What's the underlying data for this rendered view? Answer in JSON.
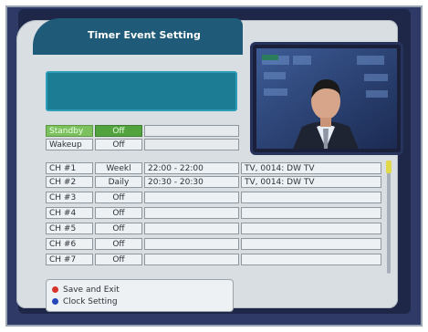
{
  "title": "Timer Event Setting",
  "standby": {
    "label": "Standby",
    "value": "Off"
  },
  "wakeup": {
    "label": "Wakeup",
    "value": "Off"
  },
  "rows": [
    {
      "ch": "CH #1",
      "mode": "Weekl",
      "time": "22:00 - 22:00",
      "channel": "TV, 0014: DW TV"
    },
    {
      "ch": "CH #2",
      "mode": "Daily",
      "time": "20:30 - 20:30",
      "channel": "TV, 0014: DW TV"
    },
    {
      "ch": "CH #3",
      "mode": "Off",
      "time": "",
      "channel": ""
    },
    {
      "ch": "CH #4",
      "mode": "Off",
      "time": "",
      "channel": ""
    },
    {
      "ch": "CH #5",
      "mode": "Off",
      "time": "",
      "channel": ""
    },
    {
      "ch": "CH #6",
      "mode": "Off",
      "time": "",
      "channel": ""
    },
    {
      "ch": "CH #7",
      "mode": "Off",
      "time": "",
      "channel": ""
    }
  ],
  "footer": {
    "save_exit": "Save and Exit",
    "clock_setting": "Clock Setting"
  },
  "colors": {
    "accent_green": "#52a33e",
    "panel_teal": "#1c7c93",
    "red_button": "#d8362c",
    "blue_button": "#2446b8"
  }
}
